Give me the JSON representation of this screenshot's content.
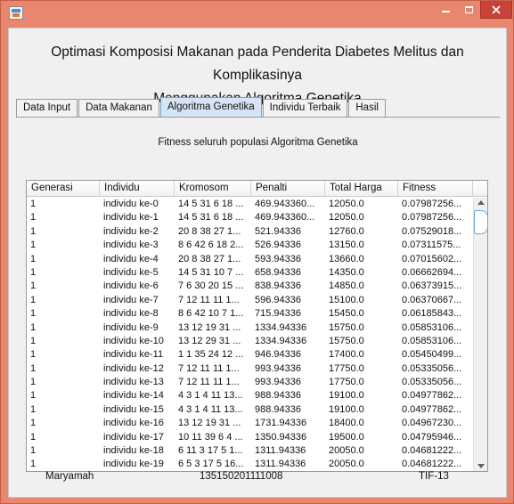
{
  "window": {
    "minimize_icon": "minimize-icon",
    "maximize_icon": "maximize-icon",
    "close_icon": "close-icon",
    "close_color": "#c7433a",
    "frame_color": "#e9866f"
  },
  "heading": {
    "line1": "Optimasi Komposisi Makanan pada Penderita Diabetes Melitus dan Komplikasinya",
    "line2": "Menggunakan Algoritma Genetika"
  },
  "tabs": [
    {
      "label": "Data Input",
      "active": false
    },
    {
      "label": "Data Makanan",
      "active": false
    },
    {
      "label": "Algoritma Genetika",
      "active": true
    },
    {
      "label": "Individu Terbaik",
      "active": false
    },
    {
      "label": "Hasil",
      "active": false
    }
  ],
  "panel_title": "Fitness seluruh populasi Algoritma Genetika",
  "table": {
    "columns": [
      "Generasi",
      "Individu",
      "Kromosom",
      "Penalti",
      "Total Harga",
      "Fitness"
    ],
    "rows": [
      [
        "1",
        "individu ke-0",
        "14 5 31 6 18 ...",
        "469.943360...",
        "12050.0",
        "0.07987256..."
      ],
      [
        "1",
        "individu ke-1",
        "14 5 31 6 18 ...",
        "469.943360...",
        "12050.0",
        "0.07987256..."
      ],
      [
        "1",
        "individu ke-2",
        "20 8 38 27 1...",
        "521.94336",
        "12760.0",
        "0.07529018..."
      ],
      [
        "1",
        "individu ke-3",
        "8 6 42 6 18 2...",
        "526.94336",
        "13150.0",
        "0.07311575..."
      ],
      [
        "1",
        "individu ke-4",
        "20 8 38 27 1...",
        "593.94336",
        "13660.0",
        "0.07015602..."
      ],
      [
        "1",
        "individu ke-5",
        "14 5 31 10 7 ...",
        "658.94336",
        "14350.0",
        "0.06662694..."
      ],
      [
        "1",
        "individu ke-6",
        "7 6 30 20 15 ...",
        "838.94336",
        "14850.0",
        "0.06373915..."
      ],
      [
        "1",
        "individu ke-7",
        "7 12 11 11 1...",
        "596.94336",
        "15100.0",
        "0.06370667..."
      ],
      [
        "1",
        "individu ke-8",
        "8 6 42 10 7 1...",
        "715.94336",
        "15450.0",
        "0.06185843..."
      ],
      [
        "1",
        "individu ke-9",
        "13 12 19 31 ...",
        "1334.94336",
        "15750.0",
        "0.05853106..."
      ],
      [
        "1",
        "individu ke-10",
        "13 12 29 31 ...",
        "1334.94336",
        "15750.0",
        "0.05853106..."
      ],
      [
        "1",
        "individu ke-11",
        "1 1 35 24 12 ...",
        "946.94336",
        "17400.0",
        "0.05450499..."
      ],
      [
        "1",
        "individu ke-12",
        "7 12 11 11 1...",
        "993.94336",
        "17750.0",
        "0.05335056..."
      ],
      [
        "1",
        "individu ke-13",
        "7 12 11 11 1...",
        "993.94336",
        "17750.0",
        "0.05335056..."
      ],
      [
        "1",
        "individu ke-14",
        "4 3 1 4 11 13...",
        "988.94336",
        "19100.0",
        "0.04977862..."
      ],
      [
        "1",
        "individu ke-15",
        "4 3 1 4 11 13...",
        "988.94336",
        "19100.0",
        "0.04977862..."
      ],
      [
        "1",
        "individu ke-16",
        "13 12 19 31 ...",
        "1731.94336",
        "18400.0",
        "0.04967230..."
      ],
      [
        "1",
        "individu ke-17",
        "10 11 39 6 4 ...",
        "1350.94336",
        "19500.0",
        "0.04795946..."
      ],
      [
        "1",
        "individu ke-18",
        "6 11 3 17 5 1...",
        "1311.94336",
        "20050.0",
        "0.04681222..."
      ],
      [
        "1",
        "individu ke-19",
        "6 5 3 17 5 16...",
        "1311.94336",
        "20050.0",
        "0.04681222..."
      ]
    ]
  },
  "footer": {
    "name": "Maryamah",
    "nim": "135150201111008",
    "class": "TIF-13"
  }
}
